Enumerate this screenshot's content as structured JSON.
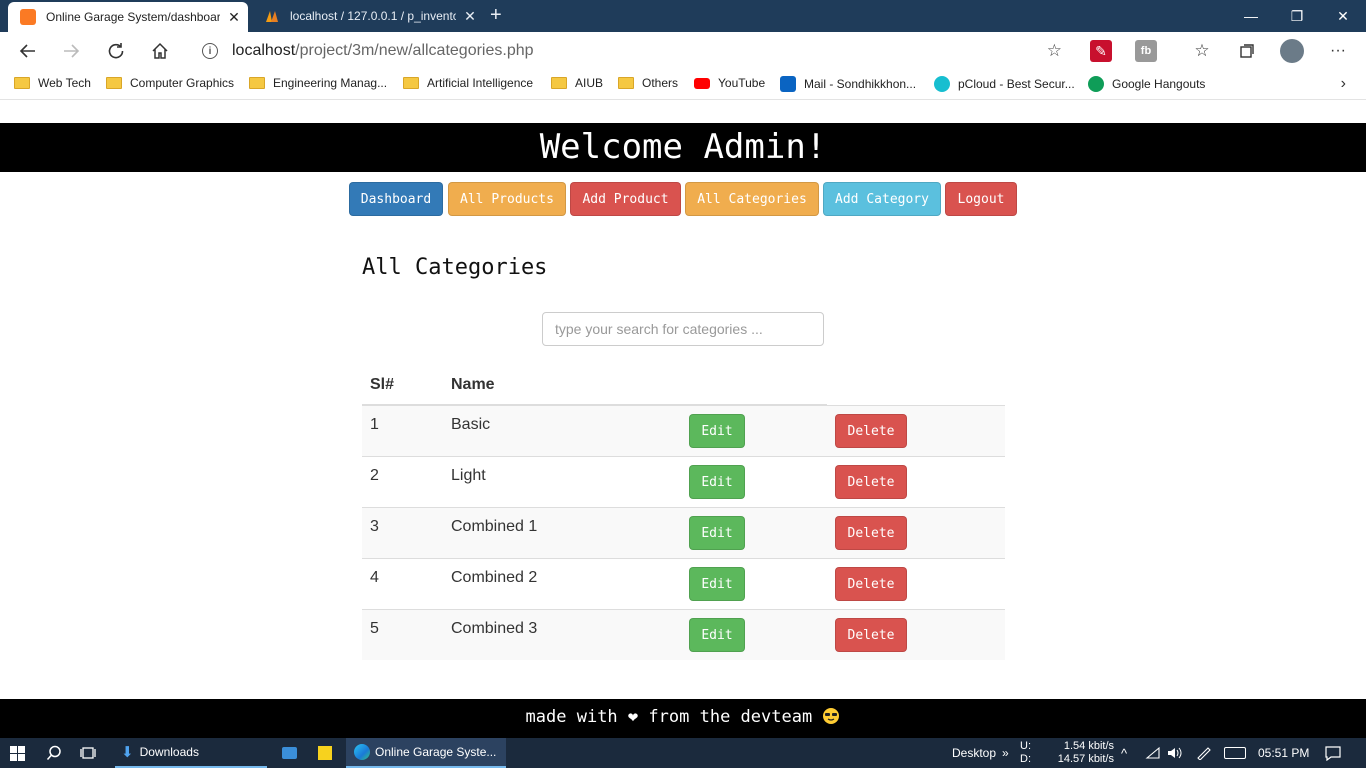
{
  "browser": {
    "tabs": [
      {
        "title": "Online Garage System/dashboar",
        "close": "✕"
      },
      {
        "title": "localhost / 127.0.0.1 / p_inventor",
        "close": "✕"
      }
    ],
    "new_tab": "+",
    "window_controls": {
      "minimize": "—",
      "restore": "❐",
      "close": "✕"
    },
    "url_host": "localhost",
    "url_path": "/project/3m/new/allcategories.php",
    "bookmarks": [
      {
        "label": "Web Tech",
        "type": "folder"
      },
      {
        "label": "Computer Graphics",
        "type": "folder"
      },
      {
        "label": "Engineering Manag...",
        "type": "folder"
      },
      {
        "label": "Artificial Intelligence",
        "type": "folder"
      },
      {
        "label": "AIUB",
        "type": "folder"
      },
      {
        "label": "Others",
        "type": "folder"
      },
      {
        "label": "YouTube",
        "type": "youtube-icon"
      },
      {
        "label": "Mail - Sondhikkhon...",
        "type": "outlook-icon"
      },
      {
        "label": "pCloud - Best Secur...",
        "type": "pcloud-icon"
      },
      {
        "label": "Google Hangouts",
        "type": "hangouts-icon"
      }
    ]
  },
  "page": {
    "header": "Welcome Admin!",
    "nav": [
      {
        "label": "Dashboard",
        "color": "#337ab7"
      },
      {
        "label": "All Products",
        "color": "#f0ad4e"
      },
      {
        "label": "Add Product",
        "color": "#d9534f"
      },
      {
        "label": "All Categories",
        "color": "#f0ad4e"
      },
      {
        "label": "Add Category",
        "color": "#5bc0de"
      },
      {
        "label": "Logout",
        "color": "#d9534f"
      }
    ],
    "title": "All Categories",
    "search_placeholder": "type your search for categories ...",
    "table": {
      "headers": [
        "Sl#",
        "Name"
      ],
      "rows": [
        {
          "sl": "1",
          "name": "Basic",
          "edit": "Edit",
          "delete": "Delete"
        },
        {
          "sl": "2",
          "name": "Light",
          "edit": "Edit",
          "delete": "Delete"
        },
        {
          "sl": "3",
          "name": "Combined 1",
          "edit": "Edit",
          "delete": "Delete"
        },
        {
          "sl": "4",
          "name": "Combined 2",
          "edit": "Edit",
          "delete": "Delete"
        },
        {
          "sl": "5",
          "name": "Combined 3",
          "edit": "Edit",
          "delete": "Delete"
        }
      ]
    },
    "footer_pre": "made with",
    "footer_post": "from the devteam"
  },
  "taskbar": {
    "downloads": "Downloads",
    "active_app": "Online Garage Syste...",
    "desktop": "Desktop",
    "upload_label": "U:",
    "download_label": "D:",
    "upload_speed": "1.54 kbit/s",
    "download_speed": "14.57 kbit/s",
    "time": "05:51 PM"
  }
}
